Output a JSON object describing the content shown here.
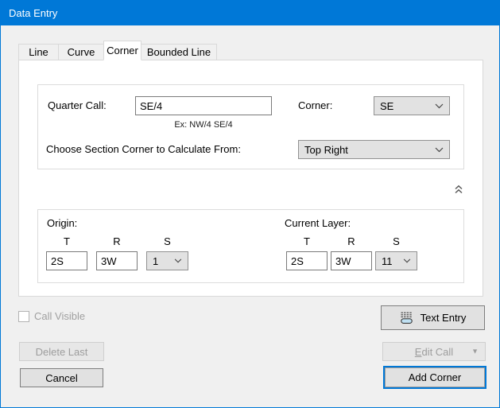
{
  "window": {
    "title": "Data Entry"
  },
  "colors": {
    "accent": "#0078D7",
    "titlebar": "#0078D7",
    "dialog_bg": "#F0F0F0"
  },
  "tabs": {
    "items": [
      {
        "label": "Line"
      },
      {
        "label": "Curve"
      },
      {
        "label": "Corner"
      },
      {
        "label": "Bounded Line"
      }
    ],
    "active": "Corner"
  },
  "call_entry": {
    "quarter_call_label": "Quarter Call:",
    "quarter_call_value": "SE/4",
    "quarter_call_hint": "Ex: NW/4 SE/4",
    "corner_label": "Corner:",
    "corner_value": "SE",
    "section_corner_label": "Choose Section Corner to Calculate From:",
    "section_corner_value": "Top Right"
  },
  "township": {
    "origin_label": "Origin:",
    "current_layer_label": "Current Layer:",
    "columns": {
      "t": "T",
      "r": "R",
      "s": "S"
    },
    "origin": {
      "t": "2S",
      "r": "3W",
      "s": "1"
    },
    "current_layer": {
      "t": "2S",
      "r": "3W",
      "s": "11"
    }
  },
  "footer": {
    "call_visible_label": "Call Visible",
    "call_visible_checked": false,
    "text_entry_label": "Text Entry",
    "delete_last_label": "Delete Last",
    "edit_call_accesskey": "E",
    "edit_call_rest": "dit Call",
    "cancel_label": "Cancel",
    "add_corner_label": "Add Corner"
  }
}
